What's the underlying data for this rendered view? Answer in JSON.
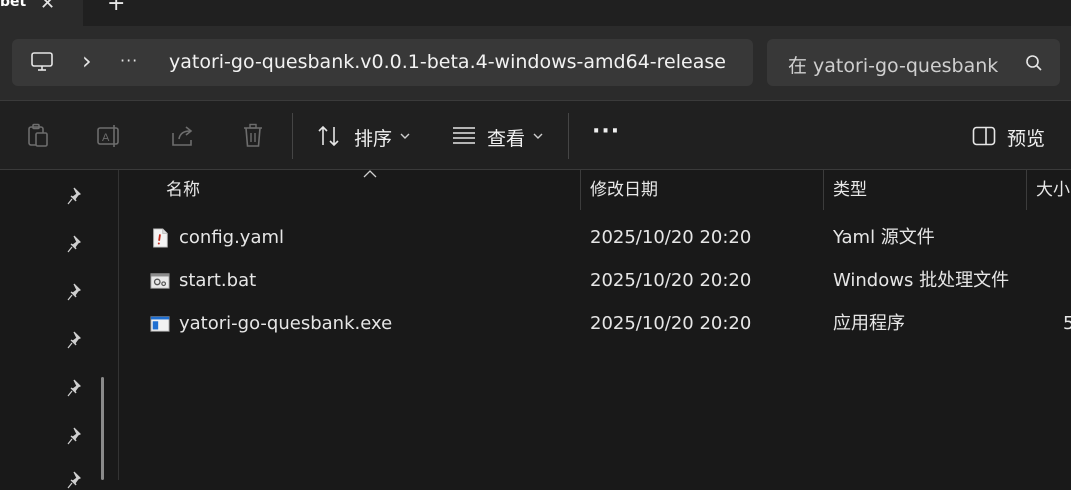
{
  "tabs": {
    "active_title": "bet",
    "close_glyph": "✕",
    "add_glyph": "+"
  },
  "address": {
    "device_icon": "computer-icon",
    "chevron": "›",
    "ellipsis": "···",
    "path": "yatori-go-quesbank.v0.0.1-beta.4-windows-amd64-release"
  },
  "search": {
    "placeholder": "在 yatori-go-quesbank",
    "icon": "search-icon"
  },
  "toolbar": {
    "icons": [
      "paste-icon",
      "rename-icon",
      "share-icon",
      "delete-icon"
    ],
    "sort_label": "排序",
    "view_label": "查看",
    "more": "···",
    "preview_label": "预览"
  },
  "columns": {
    "name": "名称",
    "modified": "修改日期",
    "type": "类型",
    "size": "大小"
  },
  "files": [
    {
      "icon": "yaml-file-icon",
      "name": "config.yaml",
      "modified": "2025/10/20 20:20",
      "type": "Yaml 源文件",
      "size": ""
    },
    {
      "icon": "batch-file-icon",
      "name": "start.bat",
      "modified": "2025/10/20 20:20",
      "type": "Windows 批处理文件",
      "size": ""
    },
    {
      "icon": "exe-file-icon",
      "name": "yatori-go-quesbank.exe",
      "modified": "2025/10/20 20:20",
      "type": "应用程序",
      "size": "5"
    }
  ],
  "colors": {
    "background": "#191919",
    "toolbar": "#202020",
    "field": "#383838",
    "accent": "#4cc2ff"
  }
}
